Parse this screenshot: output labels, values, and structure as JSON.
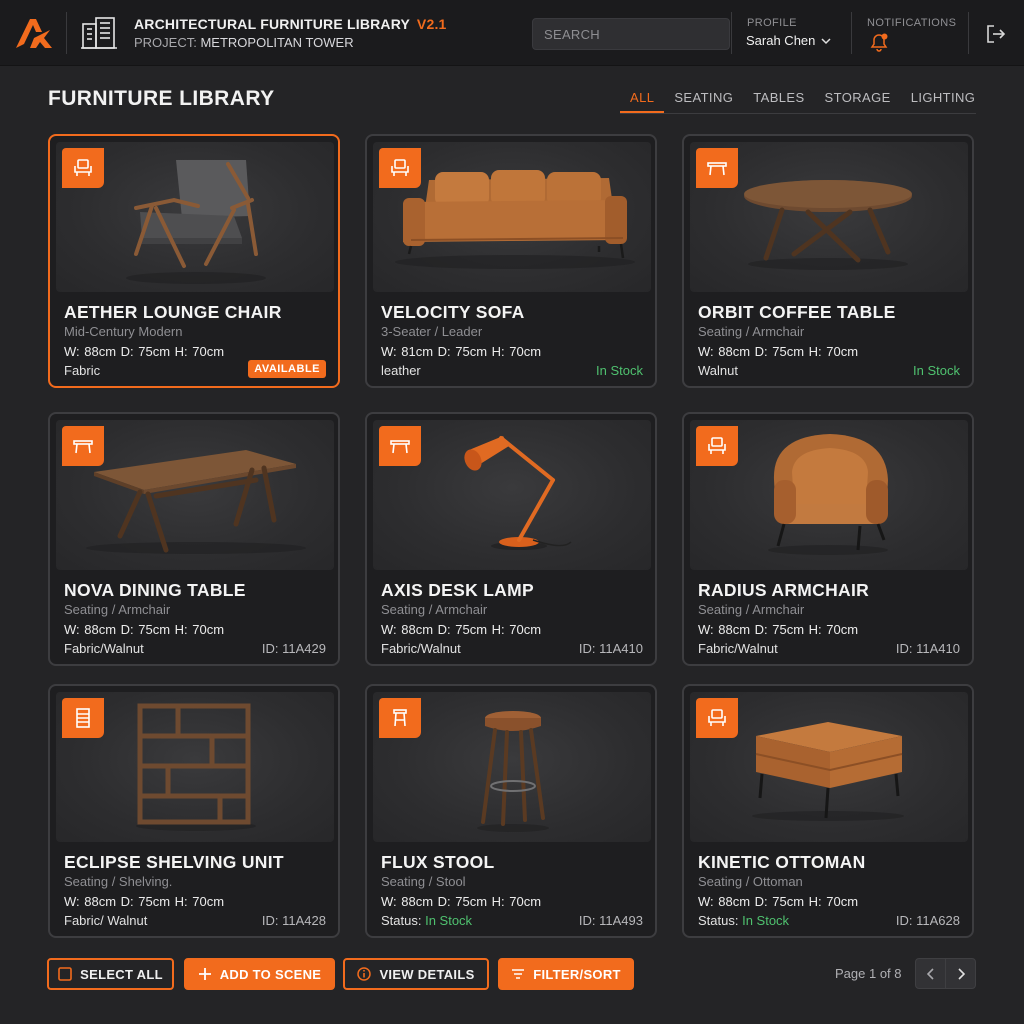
{
  "header": {
    "app_title": "ARCHITECTURAL FURNITURE LIBRARY",
    "version": "v2.1",
    "project_label": "PROJECT:",
    "project_name": "METROPOLITAN TOWER",
    "search_placeholder": "SEARCH",
    "profile_label": "PROFILE",
    "profile_name": "Sarah Chen",
    "notifications_label": "NOTIFICATIONS"
  },
  "page": {
    "title": "FURNITURE LIBRARY",
    "tabs": [
      {
        "label": "ALL",
        "active": true
      },
      {
        "label": "SEATING",
        "active": false
      },
      {
        "label": "TABLES",
        "active": false
      },
      {
        "label": "STORAGE",
        "active": false
      },
      {
        "label": "LIGHTING",
        "active": false
      }
    ]
  },
  "cards": [
    {
      "name": "AETHER LOUNGE CHAIR",
      "subtitle": "Mid-Century Modern",
      "dims": "W: 88cm  D: 75cm  H: 70cm",
      "material": "Fabric",
      "badge": "AVAILABLE",
      "category_icon": "lounge-chair-icon",
      "selected": true
    },
    {
      "name": "VELOCITY SOFA",
      "subtitle": "3-Seater / Leader",
      "dims": "W: 81cm  D: 75cm  H: 70cm",
      "material": "leather",
      "stock": "In Stock",
      "category_icon": "armchair-icon"
    },
    {
      "name": "ORBIT COFFEE TABLE",
      "subtitle": "Seating / Armchair",
      "dims": "W: 88cm  D: 75cm  H: 70cm",
      "material": "Walnut",
      "stock": "In Stock",
      "category_icon": "table-icon"
    },
    {
      "name": "NOVA DINING TABLE",
      "subtitle": "Seating / Armchair",
      "dims": "W: 88cm  D: 75cm  H: 70cm",
      "material": "Fabric/Walnut",
      "id": "ID: 11A429",
      "category_icon": "table-icon"
    },
    {
      "name": "AXIS DESK LAMP",
      "subtitle": "Seating / Armchair",
      "dims": "W: 88cm  D: 75cm  H: 70cm",
      "material": "Fabric/Walnut",
      "id": "ID: 11A410",
      "category_icon": "table-icon"
    },
    {
      "name": "RADIUS ARMCHAIR",
      "subtitle": "Seating / Armchair",
      "dims": "W: 88cm  D: 75cm  H: 70cm",
      "material": "Fabric/Walnut",
      "id": "ID: 11A410",
      "category_icon": "armchair-icon"
    },
    {
      "name": "ECLIPSE SHELVING UNIT",
      "subtitle": "Seating / Shelving.",
      "dims": "W: 88cm  D: 75cm  H: 70cm",
      "material": "Fabric/ Walnut",
      "id": "ID: 11A428",
      "category_icon": "shelving-icon"
    },
    {
      "name": "FLUX STOOL",
      "subtitle": "Seating / Stool",
      "dims": "W: 88cm  D: 75cm  H: 70cm",
      "status_label": "Status:",
      "status_value": "In Stock",
      "id": "ID: 11A493",
      "category_icon": "stool-icon"
    },
    {
      "name": "KINETIC OTTOMAN",
      "subtitle": "Seating / Ottoman",
      "dims": "W: 88cm  D: 75cm  H: 70cm",
      "status_label": "Status:",
      "status_value": "In Stock",
      "id": "ID: 11A628",
      "category_icon": "ottoman-icon"
    }
  ],
  "footer": {
    "select_all": "SELECT ALL",
    "add_to_scene": "ADD TO SCENE",
    "view_details": "VIEW DETAILS",
    "filter_sort": "FILTER/SORT",
    "pagination": "Page 1 of 8"
  },
  "colors": {
    "accent": "#f26b1d",
    "background": "#242426",
    "header_bg": "#1b1b1d",
    "card_bg": "#1e1e20",
    "in_stock": "#4fc16f"
  }
}
